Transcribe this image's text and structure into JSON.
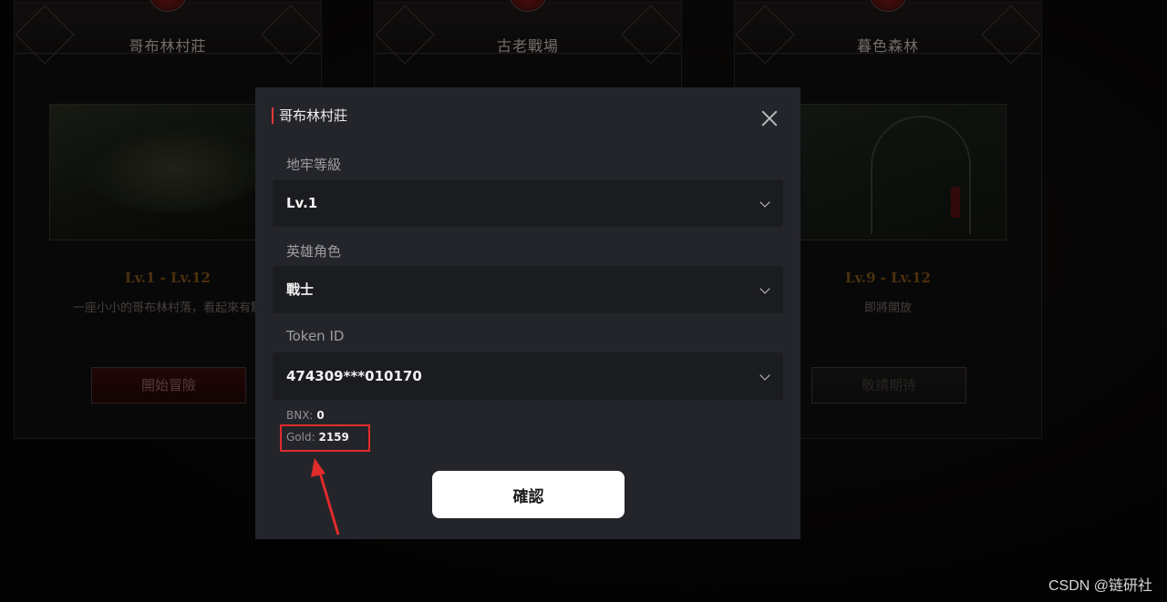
{
  "cards": [
    {
      "title": "哥布林村莊",
      "range": "Lv.1 - Lv.12",
      "description": "一座小小的哥布林村落，看起來有點",
      "button": "開始冒險"
    },
    {
      "title": "古老戰場",
      "range": "",
      "description": "",
      "button": ""
    },
    {
      "title": "暮色森林",
      "range": "Lv.9 - Lv.12",
      "description": "即將開放",
      "button": "敬請期待"
    }
  ],
  "modal": {
    "title": "哥布林村莊",
    "level_label": "地牢等級",
    "level_value": "Lv.1",
    "hero_label": "英雄角色",
    "hero_value": "戰士",
    "token_label": "Token ID",
    "token_value": "474309***010170",
    "bnx_label": "BNX:",
    "bnx_value": "0",
    "gold_label": "Gold:",
    "gold_value": "2159",
    "confirm_label": "確認"
  },
  "watermark": "CSDN @链研社",
  "colors": {
    "accent_red": "#e23b3b",
    "annotation_red": "#e12c2c",
    "modal_bg": "#24252a",
    "select_bg": "#1b1c20"
  }
}
